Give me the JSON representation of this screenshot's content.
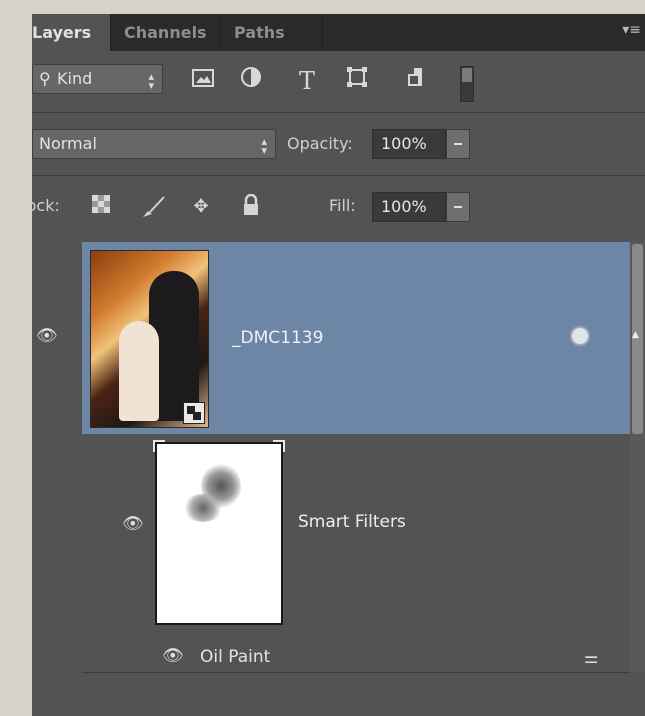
{
  "tabs": [
    {
      "label": "Layers",
      "active": true
    },
    {
      "label": "Channels",
      "active": false
    },
    {
      "label": "Paths",
      "active": false
    }
  ],
  "panel_menu_icon": "panel-menu-icon",
  "filter": {
    "kind_label": "Kind",
    "icons": [
      "pixel-layer-filter-icon",
      "adjustment-layer-filter-icon",
      "type-layer-filter-icon",
      "shape-layer-filter-icon",
      "smart-object-filter-icon",
      "filter-toggle-icon"
    ]
  },
  "blend": {
    "mode": "Normal",
    "opacity_label": "Opacity:",
    "opacity_value": "100%"
  },
  "lock": {
    "label": "Lock:",
    "icons": [
      "lock-transparent-pixels-icon",
      "lock-image-pixels-icon",
      "lock-position-icon",
      "lock-all-icon"
    ],
    "fill_label": "Fill:",
    "fill_value": "100%"
  },
  "layers": [
    {
      "name": "_DMC1139",
      "type": "smart-object",
      "selected": true
    }
  ],
  "smart_filters": {
    "label": "Smart Filters",
    "filter_name": "Oil Paint"
  },
  "colors": {
    "selected_row": "#6d86a5",
    "panel_bg": "#535353",
    "tab_bar": "#2a2a2a"
  }
}
